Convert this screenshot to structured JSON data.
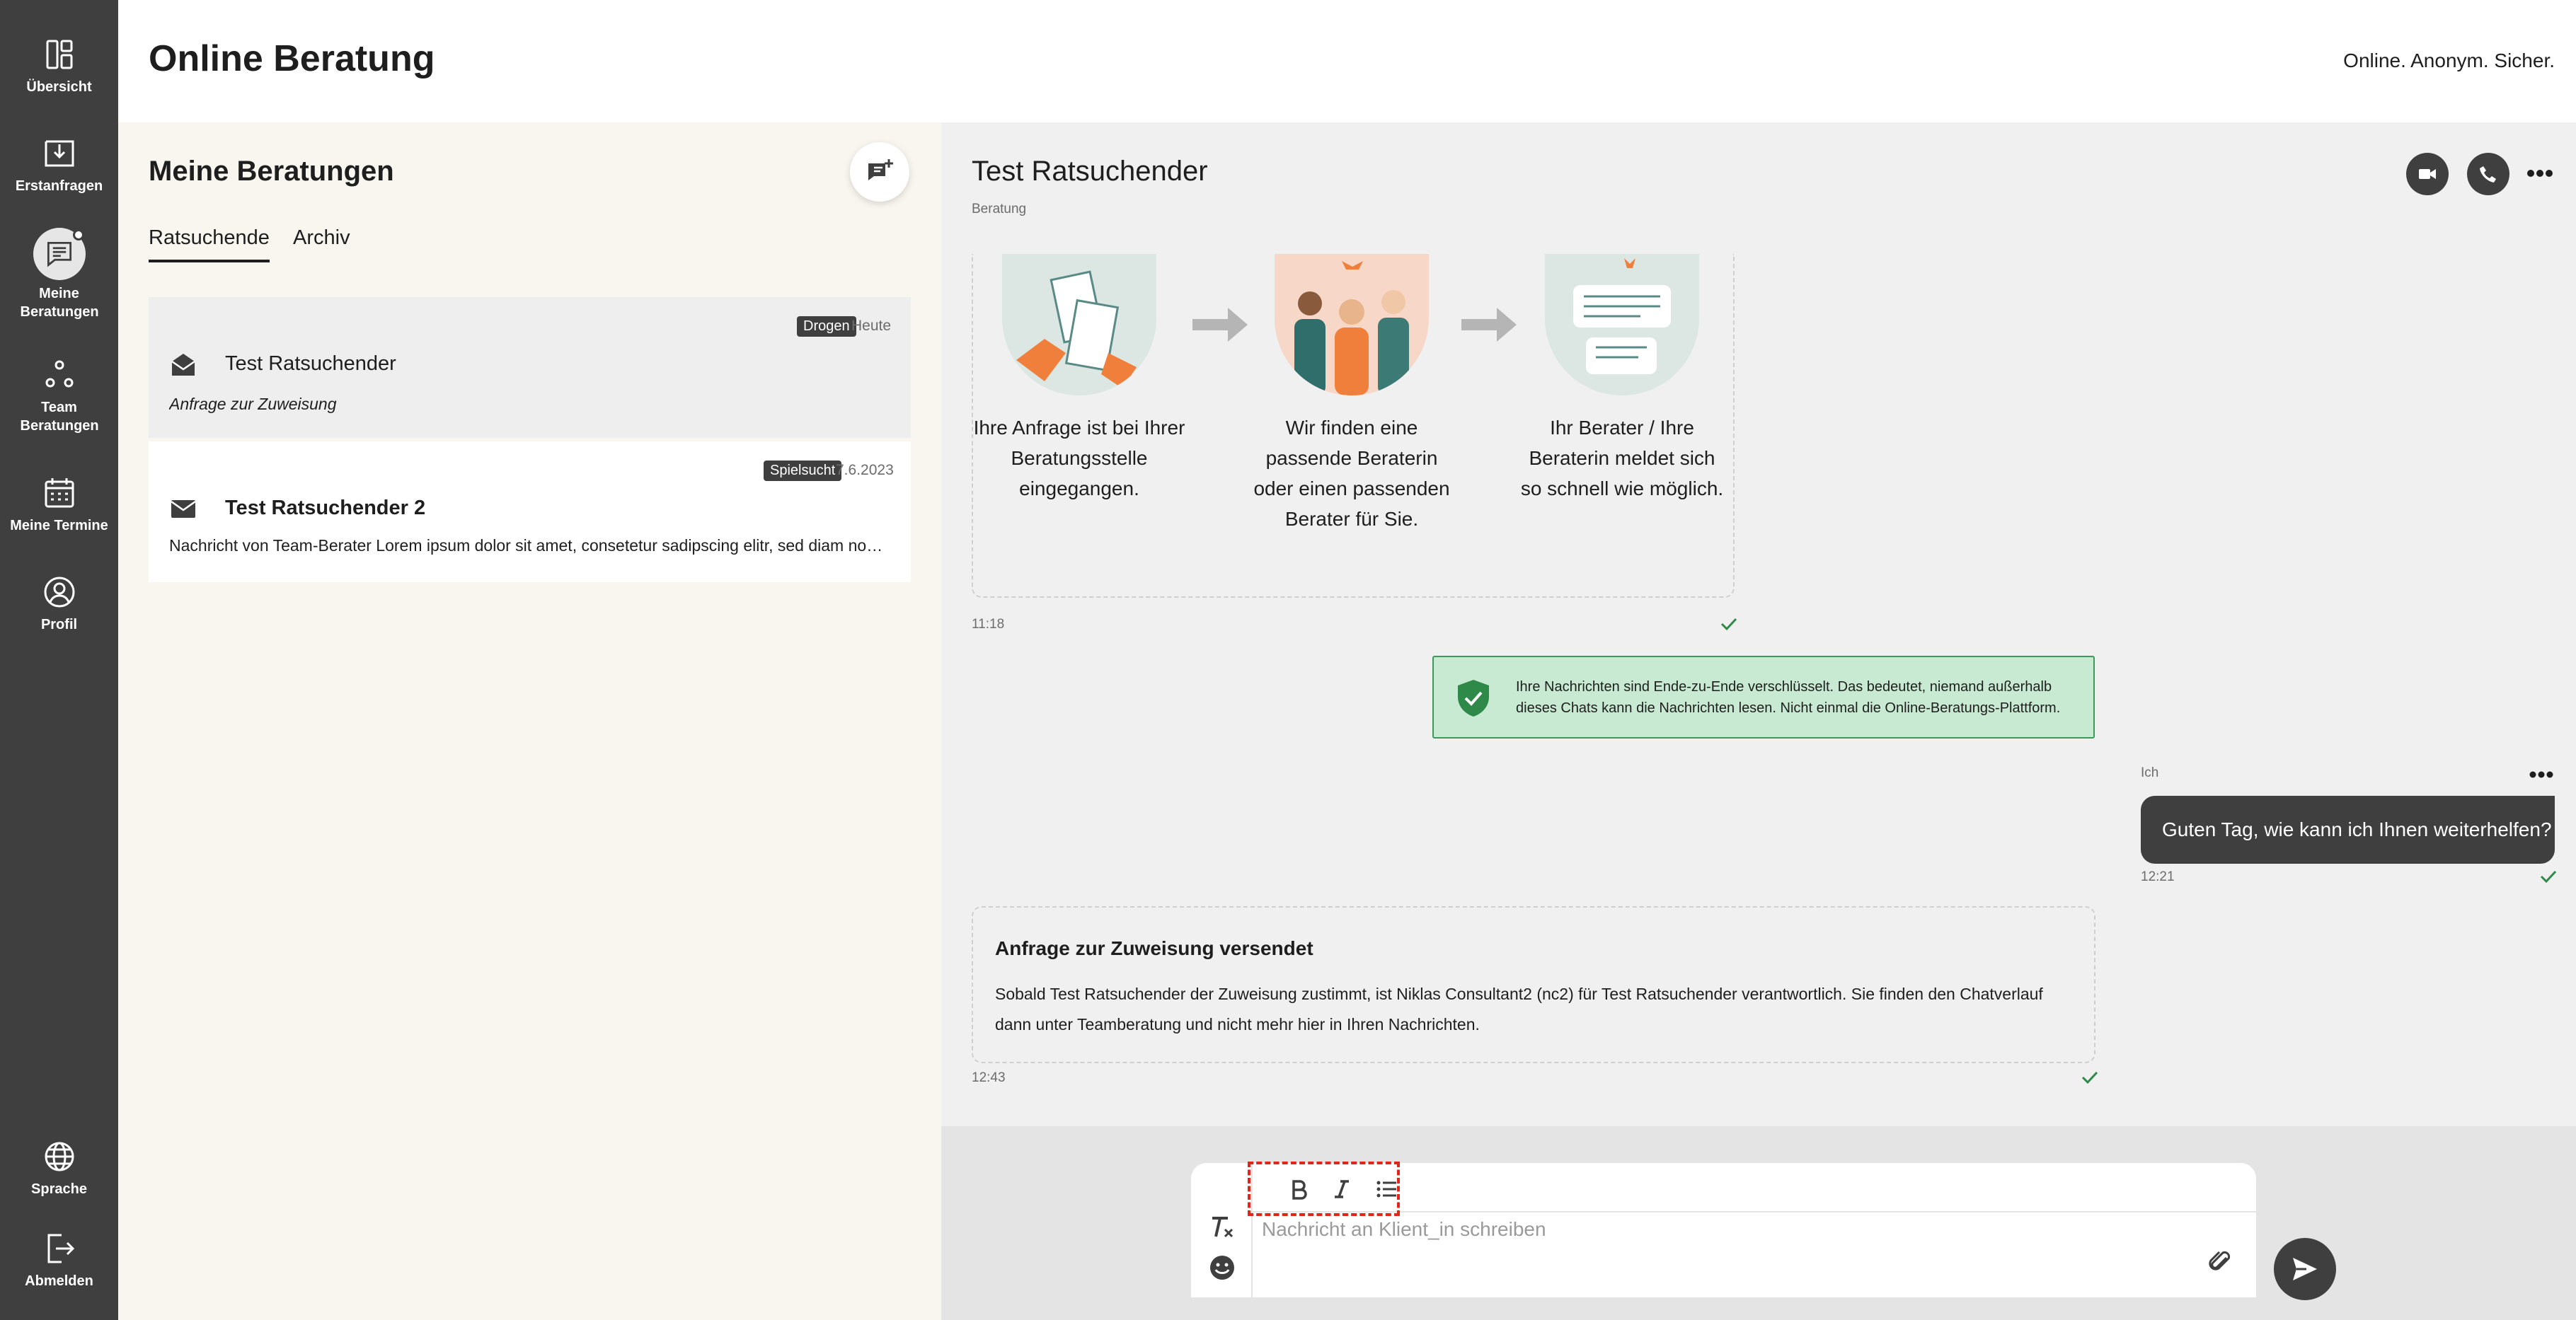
{
  "nav": {
    "items": [
      {
        "label": "Übersicht",
        "icon": "dashboard-icon"
      },
      {
        "label": "Erstanfragen",
        "icon": "inbox-download-icon"
      },
      {
        "label": "Meine Beratungen",
        "icon": "chat-list-icon"
      },
      {
        "label": "Team Beratungen",
        "icon": "team-icon"
      },
      {
        "label": "Meine Termine",
        "icon": "calendar-icon"
      },
      {
        "label": "Profil",
        "icon": "profile-icon"
      }
    ],
    "bottom": [
      {
        "label": "Sprache",
        "icon": "globe-icon"
      },
      {
        "label": "Abmelden",
        "icon": "logout-icon"
      }
    ]
  },
  "header": {
    "title": "Online Beratung",
    "tagline": "Online. Anonym. Sicher."
  },
  "sessions": {
    "title": "Meine Beratungen",
    "tabs": [
      "Ratsuchende",
      "Archiv"
    ],
    "active_tab": "Ratsuchende",
    "items": [
      {
        "name": "Test Ratsuchender",
        "tag": "Drogen",
        "date": "Heute",
        "preview": "Anfrage zur Zuweisung",
        "read": true
      },
      {
        "name": "Test Ratsuchender 2",
        "tag": "Spielsucht",
        "date": "7.6.2023",
        "preview": "Nachricht von Team-Berater Lorem ipsum dolor sit amet, consetetur sadipscing elitr, sed diam nonumy eirmod tempor",
        "read": false
      }
    ]
  },
  "chat": {
    "title": "Test Ratsuchender",
    "subtitle": "Beratung",
    "steps": [
      {
        "caption": "Ihre Anfrage ist bei Ihrer Beratungsstelle eingegangen."
      },
      {
        "caption": "Wir finden eine passende Beraterin oder einen passenden Berater für Sie."
      },
      {
        "caption": "Ihr Berater / Ihre Beraterin meldet sich so schnell wie möglich."
      }
    ],
    "info_time": "11:18",
    "e2e_notice": "Ihre Nachrichten sind Ende-zu-Ende verschlüsselt. Das bedeutet, niemand außerhalb dieses Chats kann die Nachrichten lesen. Nicht einmal die Online-Beratungs-Plattform.",
    "my_message": {
      "sender": "Ich",
      "text": "Guten Tag, wie kann ich Ihnen weiterhelfen?",
      "time": "12:21"
    },
    "system_message": {
      "title": "Anfrage zur Zuweisung versendet",
      "body": "Sobald Test Ratsuchender der Zuweisung zustimmt, ist Niklas Consultant2 (nc2) für Test Ratsuchender verantwortlich. Sie finden den Chatverlauf dann unter Teamberatung und nicht mehr hier in Ihren Nachrichten.",
      "time": "12:43"
    }
  },
  "composer": {
    "placeholder": "Nachricht an Klient_in schreiben",
    "value": ""
  },
  "colors": {
    "nav_bg": "#3f3f3f",
    "list_bg": "#f9f6f0",
    "chat_bg": "#f0f0f1",
    "accent_green": "#3b9a5a",
    "highlight_red": "#e0251b"
  }
}
